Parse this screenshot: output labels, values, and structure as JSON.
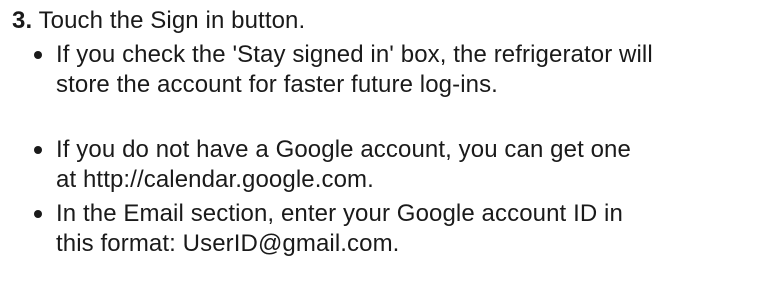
{
  "step": {
    "number": "3.",
    "text": "Touch the Sign in button."
  },
  "bullets": [
    {
      "line1": "If you check the 'Stay signed in' box, the refrigerator will",
      "line2": "store the account for faster future log-ins."
    },
    {
      "line1": "If you do not have a Google account, you can get one",
      "line2": "at http://calendar.google.com."
    },
    {
      "line1": "In the Email section, enter your Google account ID in",
      "line2": "this format: UserID@gmail.com."
    }
  ]
}
